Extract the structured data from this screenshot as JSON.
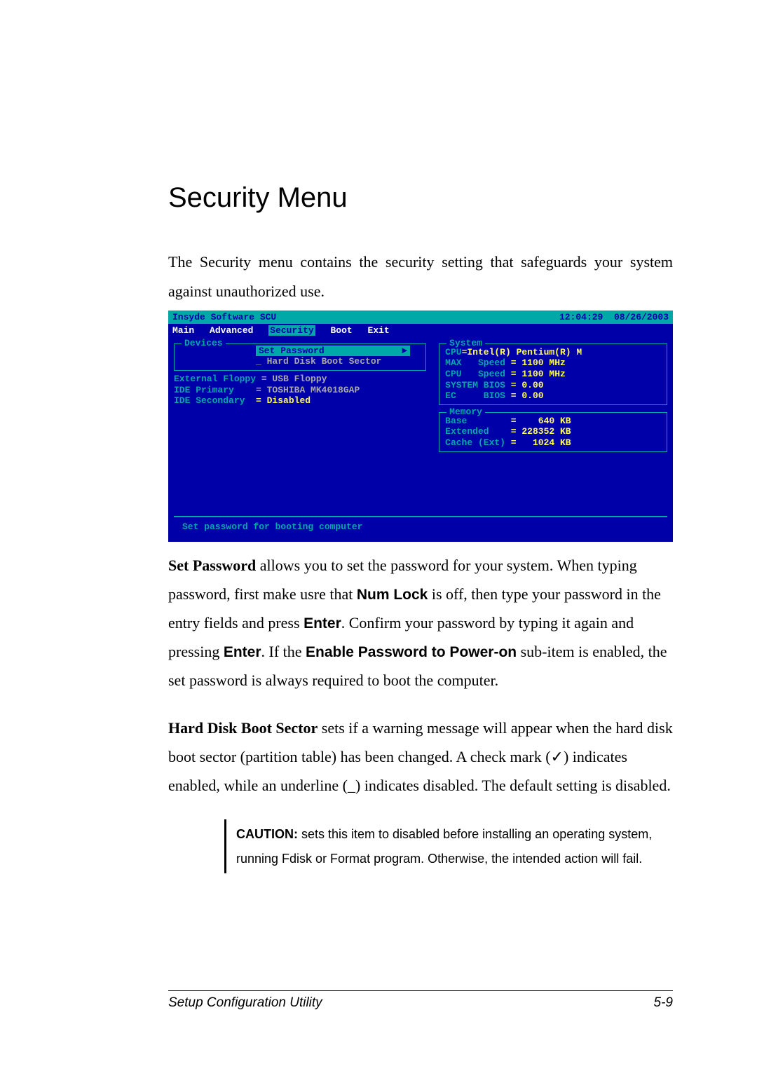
{
  "heading": "Security Menu",
  "intro": "The Security menu contains the security setting that safeguards your system against unauthorized use.",
  "bios": {
    "brand": "Insyde Software SCU",
    "clock": "12:04:29",
    "date": "08/26/2003",
    "menus": {
      "m1": "Main",
      "m2": "Advanced",
      "m3": "Security",
      "m4": "Boot",
      "m5": "Exit"
    },
    "devices_title": "Devices",
    "dropdown": {
      "sel": "Set Password",
      "arrow": "►",
      "sub": "_ Hard Disk Boot Sector"
    },
    "rows": {
      "r1a": "External Floppy ",
      "r1b": "= USB Floppy",
      "r2a": "IDE Primary    ",
      "r2b": "= TOSHIBA MK4018GAP",
      "r3a": "IDE Secondary  ",
      "r3b": "= Disabled"
    },
    "system": {
      "title": "System",
      "l1a": "CPU",
      "l1b": "=Intel(R) Pentium(R) M",
      "l2a": "MAX   Speed ",
      "l2b": "= 1100 MHz",
      "l3a": "CPU   Speed ",
      "l3b": "= 1100 MHz",
      "l4a": "SYSTEM BIOS ",
      "l4b": "= 0.00",
      "l5a": "EC     BIOS ",
      "l5b": "= 0.00"
    },
    "memory": {
      "title": "Memory",
      "l1a": "Base        ",
      "l1b": "=    640 KB",
      "l2a": "Extended    ",
      "l2b": "= 228352 KB",
      "l3a": "Cache (Ext) ",
      "l3b": "=   1024 KB"
    },
    "help": "Set password for booting computer"
  },
  "p1": {
    "lead": "Set Password",
    "t1": " allows you to set the password for your system. When typing password, first make usre that ",
    "k1": "Num Lock",
    "t2": " is off, then type your password in the entry fields and press ",
    "k2": "Enter",
    "t3": ". Confirm your password by typing it again and pressing ",
    "k3": "Enter",
    "t4": ". If the ",
    "k4": "Enable Password to Power-on",
    "t5": " sub-item is enabled, the set password is always required to boot the computer."
  },
  "p2": {
    "lead": "Hard Disk Boot Sector",
    "t1": " sets if a warning message will appear when the hard disk boot sector (partition table) has been changed. A check mark (✓) indicates enabled, while an underline (_) indicates disabled. The default setting is disabled."
  },
  "caution": {
    "label": "CAUTION:",
    "text": " sets this item to disabled before installing an operating system, running Fdisk or Format program. Otherwise, the intended action will fail."
  },
  "footer": {
    "left": "Setup Configuration Utility",
    "right": "5-9"
  }
}
